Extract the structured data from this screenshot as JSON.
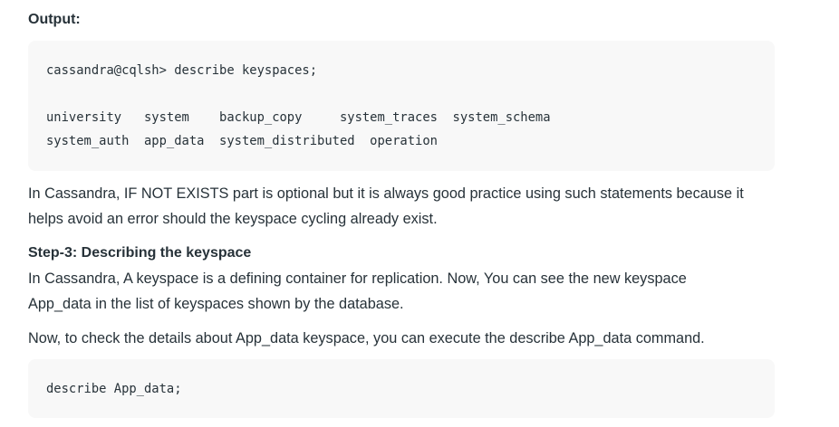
{
  "output_heading": "Output:",
  "code1": {
    "prompt_line": "cassandra@cqlsh> describe keyspaces;",
    "row1": "university   system    backup_copy     system_traces  system_schema",
    "row2": "system_auth  app_data  system_distributed  operation"
  },
  "para1": {
    "line1": "In Cassandra, IF NOT EXISTS part is optional but it is always good practice using such statements because it",
    "line2": "helps avoid an error should the keyspace cycling already exist."
  },
  "step3_heading": "Step-3: Describing the keyspace",
  "para2": {
    "line1": "In Cassandra, A keyspace is a defining container for replication. Now, You can see the new keyspace",
    "line2": "App_data in the list of keyspaces shown by the database."
  },
  "para3": "Now, to check the details about App_data keyspace, you can execute the describe App_data command.",
  "code2": {
    "line1": "describe App_data;"
  }
}
